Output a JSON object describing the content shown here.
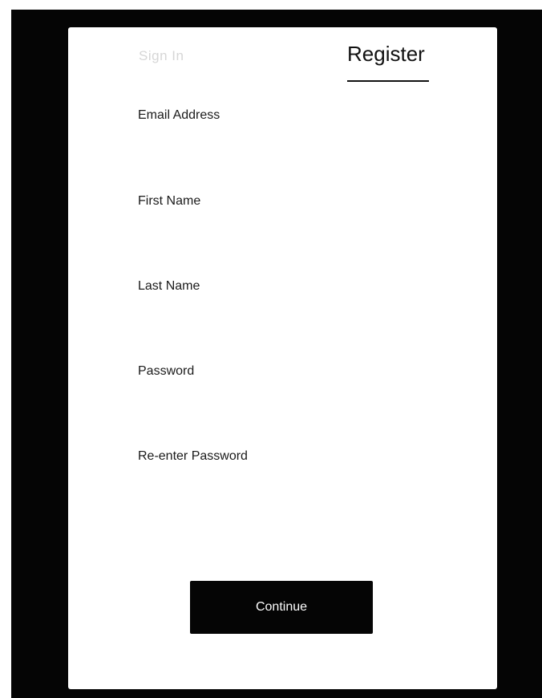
{
  "tabs": {
    "signin_label": "Sign In",
    "register_label": "Register"
  },
  "fields": [
    {
      "label": "Email Address",
      "value": ""
    },
    {
      "label": "First Name",
      "value": ""
    },
    {
      "label": "Last Name",
      "value": ""
    },
    {
      "label": "Password",
      "value": ""
    },
    {
      "label": "Re-enter Password",
      "value": ""
    }
  ],
  "actions": {
    "continue_label": "Continue"
  },
  "colors": {
    "backdrop": "#050505",
    "card": "#ffffff",
    "button": "#050505",
    "inactive_tab": "#d6d6d6",
    "text": "#111111"
  }
}
